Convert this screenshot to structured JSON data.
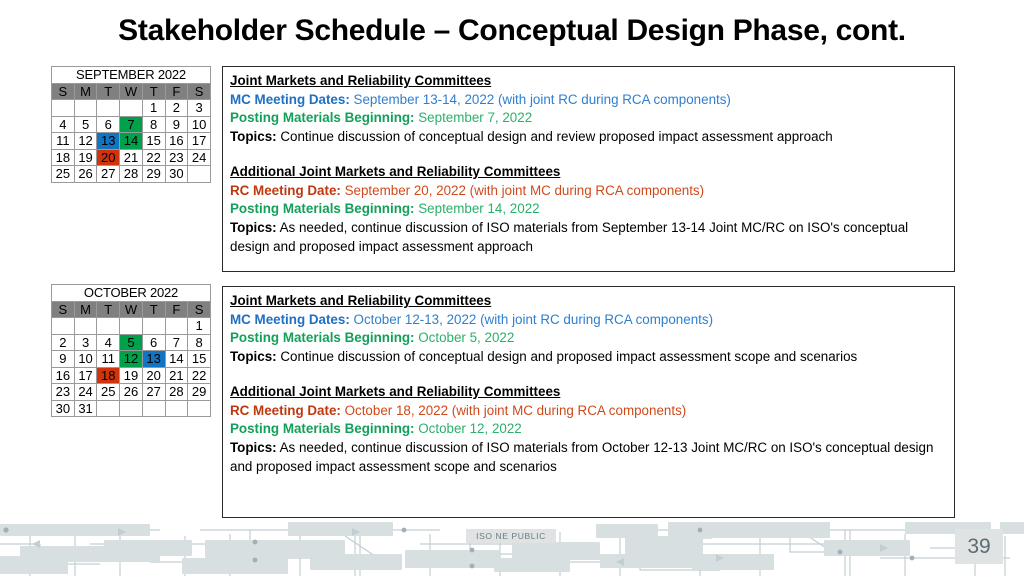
{
  "slide": {
    "title": "Stakeholder Schedule – Conceptual Design Phase, cont.",
    "page_number": "39",
    "footer_label": "ISO NE PUBLIC"
  },
  "colors": {
    "meeting_blue": "#1275C4",
    "posting_green": "#00A14B",
    "rc_red": "#D0340C",
    "dow_header_gray": "#808080"
  },
  "calendars": [
    {
      "id": "september",
      "title": "SEPTEMBER 2022",
      "dow": [
        "S",
        "M",
        "T",
        "W",
        "T",
        "F",
        "S"
      ],
      "weeks": [
        [
          {
            "d": ""
          },
          {
            "d": ""
          },
          {
            "d": ""
          },
          {
            "d": ""
          },
          {
            "d": "1"
          },
          {
            "d": "2"
          },
          {
            "d": "3"
          }
        ],
        [
          {
            "d": "4"
          },
          {
            "d": "5"
          },
          {
            "d": "6"
          },
          {
            "d": "7",
            "hl": "hl-green"
          },
          {
            "d": "8"
          },
          {
            "d": "9"
          },
          {
            "d": "10"
          }
        ],
        [
          {
            "d": "11"
          },
          {
            "d": "12"
          },
          {
            "d": "13",
            "hl": "hl-blue"
          },
          {
            "d": "14",
            "hl": "hl-greenb"
          },
          {
            "d": "15"
          },
          {
            "d": "16"
          },
          {
            "d": "17"
          }
        ],
        [
          {
            "d": "18"
          },
          {
            "d": "19"
          },
          {
            "d": "20",
            "hl": "hl-red"
          },
          {
            "d": "21"
          },
          {
            "d": "22"
          },
          {
            "d": "23"
          },
          {
            "d": "24"
          }
        ],
        [
          {
            "d": "25"
          },
          {
            "d": "26"
          },
          {
            "d": "27"
          },
          {
            "d": "28"
          },
          {
            "d": "29"
          },
          {
            "d": "30"
          },
          {
            "d": ""
          }
        ]
      ]
    },
    {
      "id": "october",
      "title": "OCTOBER 2022",
      "dow": [
        "S",
        "M",
        "T",
        "W",
        "T",
        "F",
        "S"
      ],
      "weeks": [
        [
          {
            "d": ""
          },
          {
            "d": ""
          },
          {
            "d": ""
          },
          {
            "d": ""
          },
          {
            "d": ""
          },
          {
            "d": ""
          },
          {
            "d": "1"
          }
        ],
        [
          {
            "d": "2"
          },
          {
            "d": "3"
          },
          {
            "d": "4"
          },
          {
            "d": "5",
            "hl": "hl-green"
          },
          {
            "d": "6"
          },
          {
            "d": "7"
          },
          {
            "d": "8"
          }
        ],
        [
          {
            "d": "9"
          },
          {
            "d": "10"
          },
          {
            "d": "11"
          },
          {
            "d": "12",
            "hl": "hl-greenb"
          },
          {
            "d": "13",
            "hl": "hl-bluec"
          },
          {
            "d": "14"
          },
          {
            "d": "15"
          }
        ],
        [
          {
            "d": "16"
          },
          {
            "d": "17"
          },
          {
            "d": "18",
            "hl": "hl-red"
          },
          {
            "d": "19"
          },
          {
            "d": "20"
          },
          {
            "d": "21"
          },
          {
            "d": "22"
          }
        ],
        [
          {
            "d": "23"
          },
          {
            "d": "24"
          },
          {
            "d": "25"
          },
          {
            "d": "26"
          },
          {
            "d": "27"
          },
          {
            "d": "28"
          },
          {
            "d": "29"
          }
        ],
        [
          {
            "d": "30"
          },
          {
            "d": "31"
          },
          {
            "d": ""
          },
          {
            "d": ""
          },
          {
            "d": ""
          },
          {
            "d": ""
          },
          {
            "d": ""
          }
        ]
      ]
    }
  ],
  "textboxes": {
    "september": {
      "joint": {
        "heading": "Joint Markets and Reliability Committees",
        "meeting_label": "MC Meeting Dates:",
        "meeting_value": "September 13-14, 2022 (with joint RC during RCA components)",
        "posting_label": "Posting Materials Beginning:",
        "posting_value": "September 7, 2022",
        "topics_label": "Topics:",
        "topics_value": "Continue discussion of conceptual design and review proposed impact assessment approach"
      },
      "additional": {
        "heading": "Additional Joint Markets and Reliability Committees",
        "meeting_label": "RC Meeting Date:",
        "meeting_value": "September 20, 2022 (with joint MC during RCA components)",
        "posting_label": "Posting Materials Beginning:",
        "posting_value": "September 14, 2022",
        "topics_label": "Topics:",
        "topics_value": "As needed, continue discussion of ISO materials from September 13-14 Joint MC/RC on ISO's conceptual design and proposed impact assessment approach"
      }
    },
    "october": {
      "joint": {
        "heading": "Joint Markets and Reliability Committees",
        "meeting_label": "MC Meeting Dates:",
        "meeting_value": "October 12-13, 2022 (with joint RC during RCA components)",
        "posting_label": "Posting Materials Beginning:",
        "posting_value": "October 5, 2022",
        "topics_label": "Topics:",
        "topics_value": "Continue discussion of conceptual design and proposed impact assessment scope and scenarios"
      },
      "additional": {
        "heading": "Additional Joint Markets and Reliability Committees",
        "meeting_label": "RC Meeting Date:",
        "meeting_value": "October 18, 2022 (with joint MC during RCA components)",
        "posting_label": "Posting Materials Beginning:",
        "posting_value": "October 12, 2022",
        "topics_label": "Topics:",
        "topics_value": "As needed, continue discussion of ISO materials from October 12-13 Joint MC/RC on ISO's conceptual design and proposed impact assessment scope and scenarios"
      }
    }
  }
}
